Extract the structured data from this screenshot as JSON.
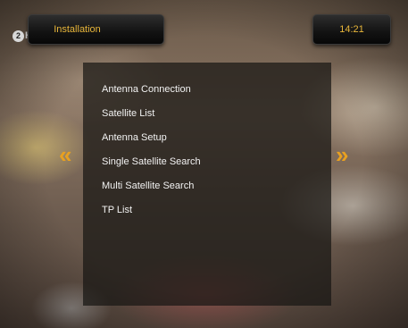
{
  "header": {
    "title": "Installation",
    "time": "14:21"
  },
  "channel_logo": {
    "mark": "2",
    "text": "HD"
  },
  "menu": {
    "items": [
      {
        "label": "Antenna Connection"
      },
      {
        "label": "Satellite List"
      },
      {
        "label": "Antenna Setup"
      },
      {
        "label": "Single Satellite Search"
      },
      {
        "label": "Multi Satellite Search"
      },
      {
        "label": "TP List"
      }
    ]
  },
  "nav": {
    "left_arrow": "«",
    "right_arrow": "»"
  },
  "colors": {
    "accent": "#e8b63a",
    "arrow": "#e8a020",
    "menu_text": "#f2f2f2"
  }
}
